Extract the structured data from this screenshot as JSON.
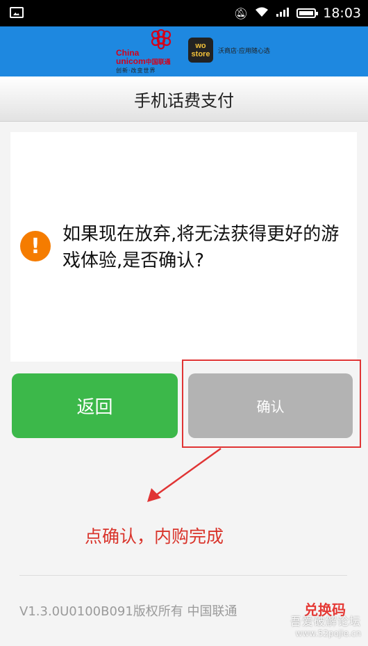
{
  "status_bar": {
    "time": "18:03",
    "icons": [
      "image-icon",
      "mute-icon",
      "wifi-icon",
      "signal-icon",
      "battery-icon"
    ]
  },
  "header": {
    "unicom_name_en_1": "China",
    "unicom_name_en_2": "unicom",
    "unicom_name_cn": "中国联通",
    "unicom_slogan": "创新·改变世界",
    "wo_store_1": "wo",
    "wo_store_2": "store",
    "wo_tagline": "沃商店·应用随心选",
    "background_color": "#1e88e0"
  },
  "title_bar": {
    "title": "手机话费支付"
  },
  "dialog": {
    "icon": "warning-icon",
    "icon_glyph": "!",
    "message": "如果现在放弃,将无法获得更好的游戏体验,是否确认?"
  },
  "buttons": {
    "back_label": "返回",
    "confirm_label": "确认",
    "back_color": "#3cb84a",
    "confirm_color": "#b3b3b3"
  },
  "annotation": {
    "text": "点确认，内购完成",
    "color": "#d9342b"
  },
  "footer": {
    "copyright": "V1.3.0U0100B091版权所有 中国联通",
    "redeem_label": "兑换码"
  },
  "watermark": {
    "line1": "吾爱破解论坛",
    "line2": "www.52pojie.cn"
  }
}
